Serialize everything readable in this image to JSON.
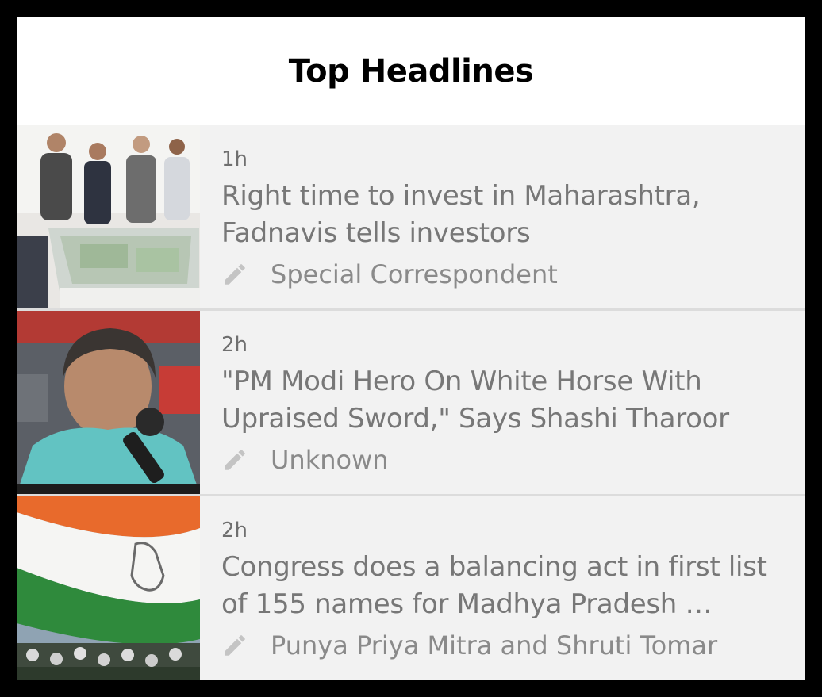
{
  "header": {
    "title": "Top Headlines"
  },
  "articles": [
    {
      "time": "1h",
      "title": "Right time to invest in Maharashtra, Fadnavis tells investors",
      "author": "Special Correspondent",
      "author_icon": "pencil-icon"
    },
    {
      "time": "2h",
      "title": "\"PM Modi Hero On White Horse With Upraised Sword,\" Says Shashi Tharoor",
      "author": "Unknown",
      "author_icon": "pencil-icon"
    },
    {
      "time": "2h",
      "title": "Congress does a balancing act in first list of 155 names for Madhya Pradesh …",
      "author": "Punya Priya Mitra and Shruti Tomar",
      "author_icon": "pencil-icon"
    }
  ],
  "colors": {
    "background": "#000000",
    "card": "#f2f2f2",
    "divider": "#dcdcdc",
    "title_text": "#777777",
    "meta_text": "#8a8a8a"
  }
}
